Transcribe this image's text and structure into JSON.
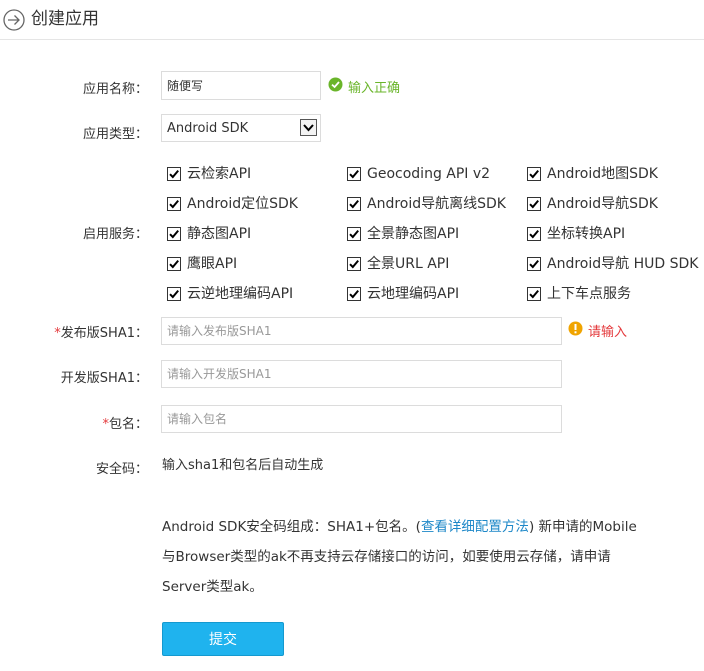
{
  "header": {
    "title": "创建应用"
  },
  "form": {
    "app_name": {
      "label": "应用名称：",
      "value": "随便写",
      "valid_text": "输入正确"
    },
    "app_type": {
      "label": "应用类型：",
      "selected": "Android SDK"
    },
    "services": {
      "label": "启用服务：",
      "items": [
        {
          "label": "云检索API",
          "checked": true
        },
        {
          "label": "Geocoding API v2",
          "checked": true
        },
        {
          "label": "Android地图SDK",
          "checked": true
        },
        {
          "label": "Android定位SDK",
          "checked": true
        },
        {
          "label": "Android导航离线SDK",
          "checked": true
        },
        {
          "label": "Android导航SDK",
          "checked": true
        },
        {
          "label": "静态图API",
          "checked": true
        },
        {
          "label": "全景静态图API",
          "checked": true
        },
        {
          "label": "坐标转换API",
          "checked": true
        },
        {
          "label": "鹰眼API",
          "checked": true
        },
        {
          "label": "全景URL API",
          "checked": true
        },
        {
          "label": "Android导航 HUD SDK",
          "checked": true
        },
        {
          "label": "云逆地理编码API",
          "checked": true
        },
        {
          "label": "云地理编码API",
          "checked": true
        },
        {
          "label": "上下车点服务",
          "checked": true
        }
      ]
    },
    "release_sha1": {
      "required_mark": "*",
      "label": "发布版SHA1：",
      "placeholder": "请输入发布版SHA1",
      "warning": "请输入"
    },
    "dev_sha1": {
      "label": "开发版SHA1：",
      "placeholder": "请输入开发版SHA1"
    },
    "package": {
      "required_mark": "*",
      "label": "包名：",
      "placeholder": "请输入包名"
    },
    "security_code": {
      "label": "安全码：",
      "value": "输入sha1和包名后自动生成"
    },
    "info": {
      "line1_prefix": "Android SDK安全码组成：SHA1+包名。(",
      "link": "查看详细配置方法",
      "line1_suffix": ") 新申请的Mobile",
      "line2": "与Browser类型的ak不再支持云存储接口的访问，如要使用云存储，请申请",
      "line3": "Server类型ak。"
    },
    "submit_label": "提交"
  },
  "colors": {
    "accent": "#1fb3ee",
    "valid": "#6ab52a",
    "error": "#e4393c",
    "link": "#1e88c8"
  },
  "icons": [
    "back-arrow-circle-icon",
    "check-circle-icon",
    "chevron-down-icon",
    "checkmark-icon",
    "exclamation-circle-icon"
  ]
}
